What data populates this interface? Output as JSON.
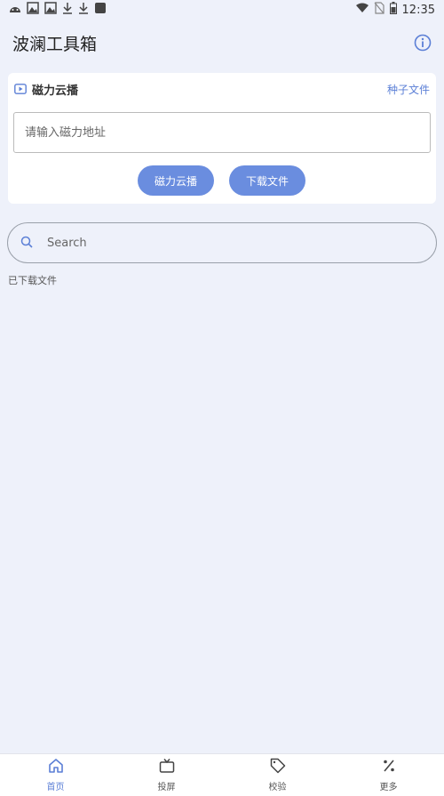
{
  "status_bar": {
    "time": "12:35",
    "left_icons": [
      "android-icon",
      "image-icon",
      "image-icon",
      "download-icon",
      "download-icon",
      "square-icon"
    ],
    "right_icons": [
      "wifi-icon",
      "no-sim-icon",
      "battery-icon"
    ]
  },
  "header": {
    "title": "波澜工具箱",
    "info_icon": "info-icon"
  },
  "magnet_card": {
    "title": "磁力云播",
    "torrent_link": "种子文件",
    "input_placeholder": "请输入磁力地址",
    "cloud_play_button": "磁力云播",
    "download_button": "下载文件"
  },
  "search": {
    "placeholder": "Search"
  },
  "downloaded_label": "已下载文件",
  "bottom_nav": {
    "items": [
      {
        "label": "首页",
        "icon": "home-icon",
        "active": true
      },
      {
        "label": "投屏",
        "icon": "tv-icon",
        "active": false
      },
      {
        "label": "校验",
        "icon": "tag-icon",
        "active": false
      },
      {
        "label": "更多",
        "icon": "percent-icon",
        "active": false
      }
    ]
  },
  "colors": {
    "accent": "#6a8ddf",
    "link": "#5b7fd6",
    "background": "#eef1fa"
  }
}
